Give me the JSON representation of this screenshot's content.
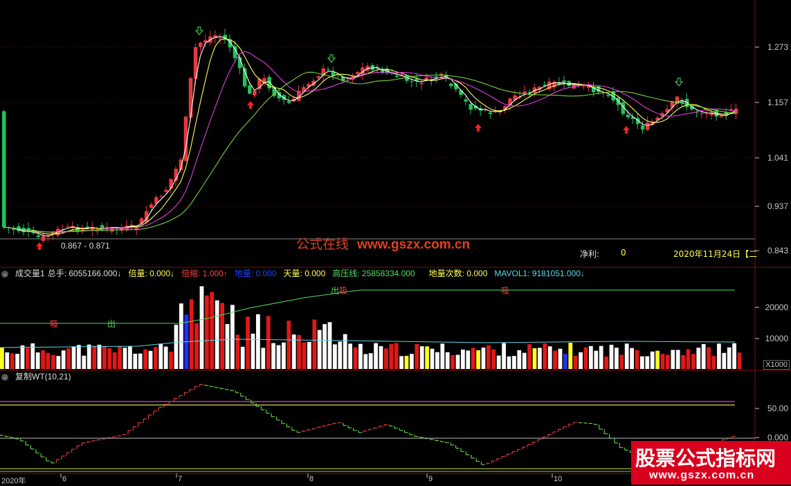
{
  "price_axis": [
    "1.273",
    "1.157",
    "1.041",
    "0.937",
    "0.843"
  ],
  "range_label": "0.867 - 0.871",
  "watermark": {
    "cn": "公式在线",
    "url": "www.gszx.com.cn"
  },
  "net_profit": {
    "label": "净利:",
    "value": "0"
  },
  "date_info": "2020年11月24日【二",
  "volume_header": {
    "title": "成交量1",
    "total": "总手: 6055166.000↓",
    "double": "倍量: 0.000↓",
    "shrink": "倍缩: 1.000↑",
    "ground": "地量: 0.000",
    "sky": "天量: 0.000",
    "high_line": "高压线: 25858334.000",
    "ground_count": "地量次数: 0.000",
    "mavol": "MAVOL1: 9181051.000↓"
  },
  "volume_axis": [
    "20000",
    "10000"
  ],
  "volume_unit": "X1000",
  "volume_signals": {
    "buy": "吸",
    "sell": "出"
  },
  "wt_header": {
    "title": "复制WT(10,21)"
  },
  "wt_axis": [
    "50.00",
    "0.000"
  ],
  "dates": [
    "2020年",
    "6",
    "7",
    "8",
    "9",
    "10"
  ],
  "banner": {
    "title": "股票公式指标网",
    "url": "www.gszx.com.cn"
  },
  "colors": {
    "up": "#e8383d",
    "down": "#22c25a",
    "ma5": "#ffffff",
    "ma10": "#ffff55",
    "ma20": "#e040e0",
    "ma60": "#7ad33a"
  }
}
